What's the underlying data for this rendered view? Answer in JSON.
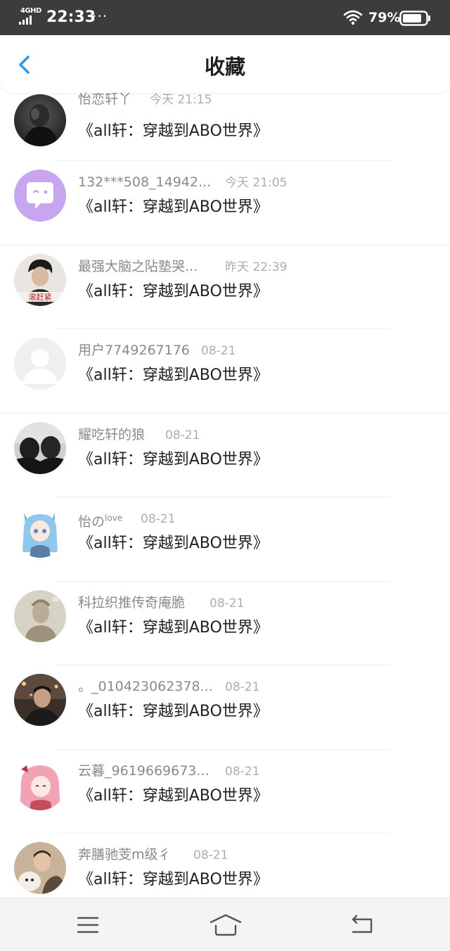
{
  "status_bar": {
    "network": "4GHD",
    "time": "22:33",
    "dots": "···",
    "battery_percent": "79%",
    "icons": [
      "signal-icon",
      "wifi-icon",
      "battery-icon"
    ]
  },
  "header": {
    "back_icon": "chevron-left-icon",
    "title": "收藏",
    "accent_color": "#2a9cf0"
  },
  "items": [
    {
      "username": "怡恋轩丫",
      "time": "今天 21:15",
      "title": "《all轩：穿越到ABO世界》"
    },
    {
      "username": "132***508_14942...",
      "time": "今天 21:05",
      "title": "《all轩：穿越到ABO世界》"
    },
    {
      "username": "最强大脑之阽塾哭...",
      "time": "昨天 22:39",
      "title": "《all轩：穿越到ABO世界》"
    },
    {
      "username": "用户7749267176",
      "time": "08-21",
      "title": "《all轩：穿越到ABO世界》"
    },
    {
      "username": "耀吃轩的狼",
      "time": "08-21",
      "title": "《all轩：穿越到ABO世界》"
    },
    {
      "username": "怡の",
      "username_sup": "love",
      "time": "08-21",
      "title": "《all轩：穿越到ABO世界》"
    },
    {
      "username": "科拉织推传奇庵脆",
      "time": "08-21",
      "title": "《all轩：穿越到ABO世界》"
    },
    {
      "username": "。_010423062378...",
      "time": "08-21",
      "title": "《all轩：穿越到ABO世界》"
    },
    {
      "username": "云暮_9619669673...",
      "time": "08-21",
      "title": "《all轩：穿越到ABO世界》"
    },
    {
      "username": "奔膳驰芰m级彳",
      "time": "08-21",
      "title": "《all轩：穿越到ABO世界》"
    }
  ],
  "bottom_nav": {
    "icons": [
      "menu-icon",
      "home-icon",
      "back-icon"
    ]
  }
}
